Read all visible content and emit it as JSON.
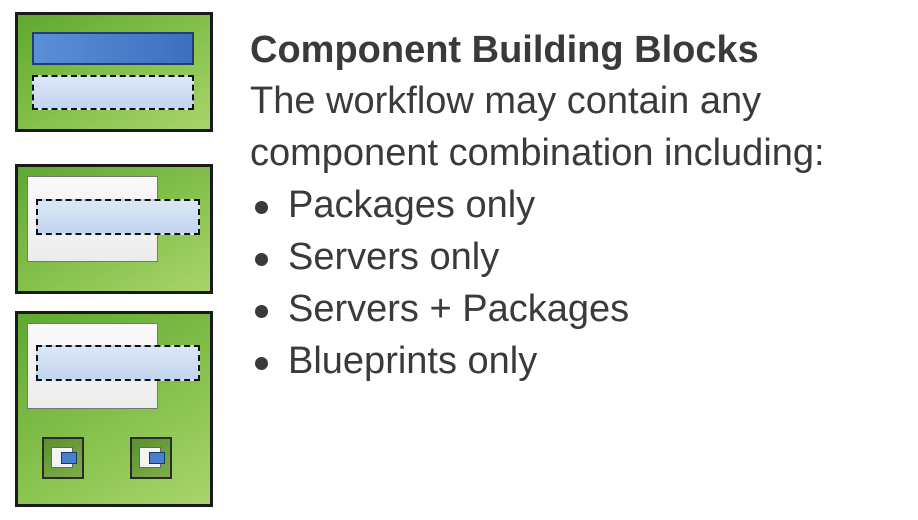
{
  "title": "Component Building Blocks",
  "description_lines": [
    "The workflow may contain any",
    "component combination including:"
  ],
  "bullets": [
    "Packages only",
    "Servers only",
    "Servers + Packages",
    "Blueprints only"
  ],
  "colors": {
    "block_green": "#86c24d",
    "package_blue": "#3d6fbf",
    "dashed_fill": "#c2d5ef",
    "text": "#3a3a3a"
  }
}
